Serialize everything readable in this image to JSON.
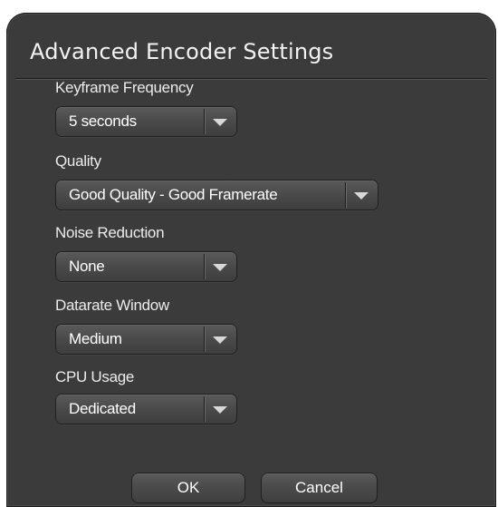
{
  "dialog": {
    "title": "Advanced Encoder Settings"
  },
  "fields": [
    {
      "label": "Keyframe Frequency",
      "value": "5 seconds"
    },
    {
      "label": "Quality",
      "value": "Good Quality - Good Framerate"
    },
    {
      "label": "Noise Reduction",
      "value": "None"
    },
    {
      "label": "Datarate Window",
      "value": "Medium"
    },
    {
      "label": "CPU Usage",
      "value": "Dedicated"
    }
  ],
  "buttons": {
    "ok": "OK",
    "cancel": "Cancel"
  },
  "icons": {
    "dropdown": "chevron-down-icon"
  },
  "colors": {
    "panel": "#3b3b3b",
    "text": "#ffffff"
  }
}
